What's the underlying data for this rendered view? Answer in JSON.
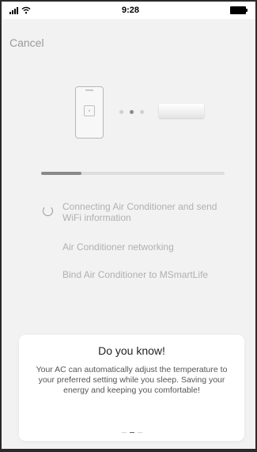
{
  "status_bar": {
    "time": "9:28"
  },
  "header": {
    "cancel_label": "Cancel"
  },
  "progress": {
    "fraction": 0.22
  },
  "steps": [
    {
      "label": "Connecting Air Conditioner and send WiFi information",
      "state": "active"
    },
    {
      "label": "Air Conditioner networking",
      "state": "pending"
    },
    {
      "label": "Bind Air Conditioner to MSmartLife",
      "state": "pending"
    }
  ],
  "info_card": {
    "title": "Do you know!",
    "body": "Your AC can automatically adjust the temperature to your preferred setting while you sleep. Saving your energy and keeping you comfortable!"
  },
  "icons": {
    "phone": "phone-icon",
    "ac": "air-conditioner-icon",
    "spinner": "loading-spinner-icon",
    "signal": "cellular-signal-icon",
    "wifi": "wifi-icon",
    "battery": "battery-icon"
  },
  "colors": {
    "background": "#f2f2f2",
    "progress_fill": "#8a8a8a",
    "progress_track": "#dedede",
    "muted_text": "#b0b0b0"
  }
}
